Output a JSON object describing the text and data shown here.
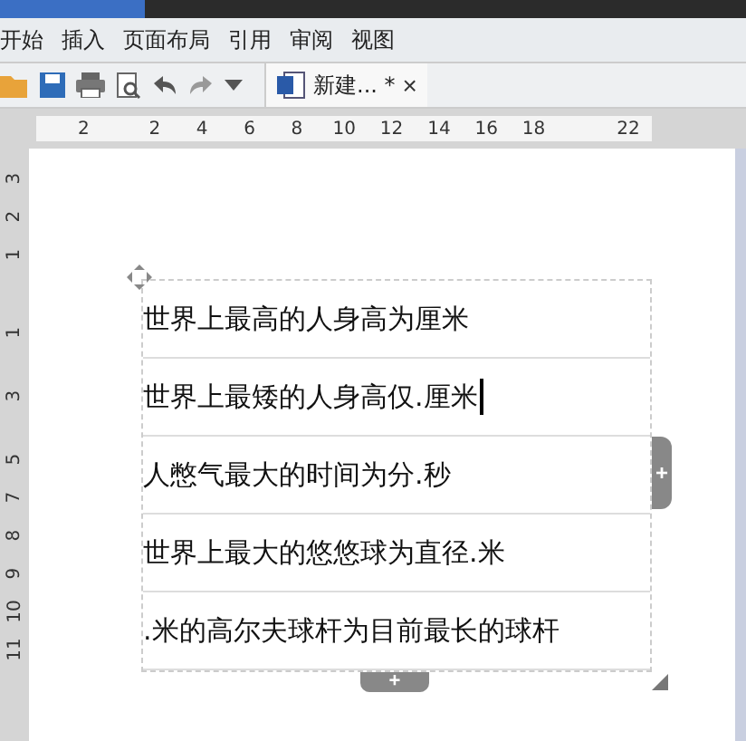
{
  "menu": [
    {
      "label": "开始",
      "selected": false
    },
    {
      "label": "插入",
      "selected": false
    },
    {
      "label": "页面布局",
      "selected": false
    },
    {
      "label": "引用",
      "selected": false
    },
    {
      "label": "审阅",
      "selected": false
    },
    {
      "label": "视图",
      "selected": false
    }
  ],
  "document_tab": {
    "title": "新建...",
    "modified": "*",
    "close": "×"
  },
  "ruler": {
    "ticks": [
      "2",
      "2",
      "4",
      "6",
      "8",
      "10",
      "12",
      "14",
      "16",
      "18",
      "22"
    ]
  },
  "vertical_ruler": {
    "ticks": [
      "3",
      "2",
      "1",
      "1",
      "3",
      "5",
      "7",
      "8",
      "9",
      "10",
      "11"
    ]
  },
  "table": {
    "rows": [
      {
        "text": "世界上最高的人身高为厘米",
        "cursor": false
      },
      {
        "text": "世界上最矮的人身高仅.厘米",
        "cursor": true
      },
      {
        "text": "人憋气最大的时间为分.秒",
        "cursor": false
      },
      {
        "text": "世界上最大的悠悠球为直径.米",
        "cursor": false
      },
      {
        "text": ".米的高尔夫球杆为目前最长的球杆",
        "cursor": false
      }
    ],
    "add_column": "+",
    "add_row": "+"
  }
}
